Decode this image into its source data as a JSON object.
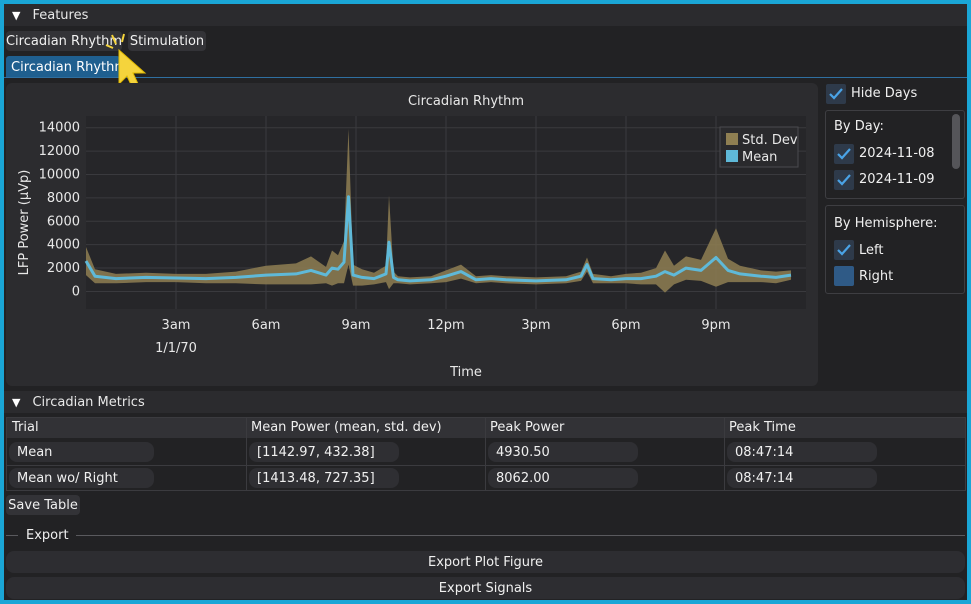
{
  "features": {
    "title": "Features",
    "tabs": [
      "Circadian Rhythm",
      "Stimulation"
    ],
    "subtab": "Circadian Rhythm"
  },
  "sidebar": {
    "hide_days_label": "Hide Days",
    "by_day_title": "By Day:",
    "days": [
      "2024-11-08",
      "2024-11-09"
    ],
    "by_hemisphere_title": "By Hemisphere:",
    "hemispheres": [
      {
        "label": "Left",
        "checked": true
      },
      {
        "label": "Right",
        "checked": false
      }
    ]
  },
  "chart_data": {
    "type": "area",
    "title": "Circadian Rhythm",
    "xlabel": "Time",
    "ylabel": "LFP Power (µVp)",
    "ylim": [
      -1500,
      15000
    ],
    "y_ticks": [
      0,
      2000,
      4000,
      6000,
      8000,
      10000,
      12000,
      14000
    ],
    "x_tick_labels": [
      "3am",
      "6am",
      "9am",
      "12pm",
      "3pm",
      "6pm",
      "9pm"
    ],
    "x_date_label": "1/1/70",
    "legend": {
      "position": "top-right",
      "entries": [
        "Std. Dev",
        "Mean"
      ]
    },
    "colors": {
      "std": "#8f7f52",
      "mean": "#5fb9d8"
    },
    "x_hours": [
      0,
      0.3,
      1,
      2,
      3,
      4,
      5,
      6,
      7,
      7.5,
      8,
      8.2,
      8.4,
      8.6,
      8.75,
      8.9,
      9.2,
      9.6,
      10,
      10.1,
      10.25,
      10.4,
      10.8,
      11.5,
      12,
      12.5,
      13,
      13.5,
      14,
      15,
      16,
      16.5,
      16.7,
      16.9,
      17.5,
      18,
      18.5,
      19,
      19.3,
      19.6,
      20,
      20.5,
      21,
      21.4,
      21.8,
      22.5,
      23,
      23.5
    ],
    "mean": [
      2600,
      1300,
      1100,
      1200,
      1150,
      1100,
      1200,
      1400,
      1500,
      1800,
      1400,
      2000,
      1900,
      2500,
      8100,
      1400,
      1200,
      1100,
      1500,
      4200,
      1200,
      1000,
      900,
      1000,
      1300,
      1700,
      1000,
      1100,
      1000,
      900,
      1000,
      1300,
      2300,
      1100,
      1000,
      1100,
      1100,
      1300,
      1700,
      1400,
      2000,
      1800,
      2900,
      1800,
      1500,
      1300,
      1200,
      1400
    ],
    "std": [
      1200,
      600,
      400,
      400,
      350,
      400,
      500,
      800,
      900,
      1200,
      700,
      1500,
      1200,
      1800,
      5800,
      900,
      700,
      500,
      700,
      4000,
      500,
      300,
      300,
      300,
      500,
      600,
      300,
      300,
      300,
      300,
      300,
      400,
      600,
      400,
      300,
      400,
      500,
      700,
      1800,
      800,
      1000,
      900,
      2500,
      1000,
      700,
      500,
      500,
      400
    ]
  },
  "metrics": {
    "title": "Circadian Metrics",
    "columns": [
      "Trial",
      "Mean Power (mean, std. dev)",
      "Peak Power",
      "Peak Time"
    ],
    "rows": [
      [
        "Mean",
        "[1142.97, 432.38]",
        "4930.50",
        "08:47:14"
      ],
      [
        "Mean wo/ Right",
        "[1413.48, 727.35]",
        "8062.00",
        "08:47:14"
      ]
    ],
    "save_label": "Save Table"
  },
  "export": {
    "title": "Export",
    "plot_label": "Export Plot Figure",
    "signals_label": "Export Signals"
  }
}
